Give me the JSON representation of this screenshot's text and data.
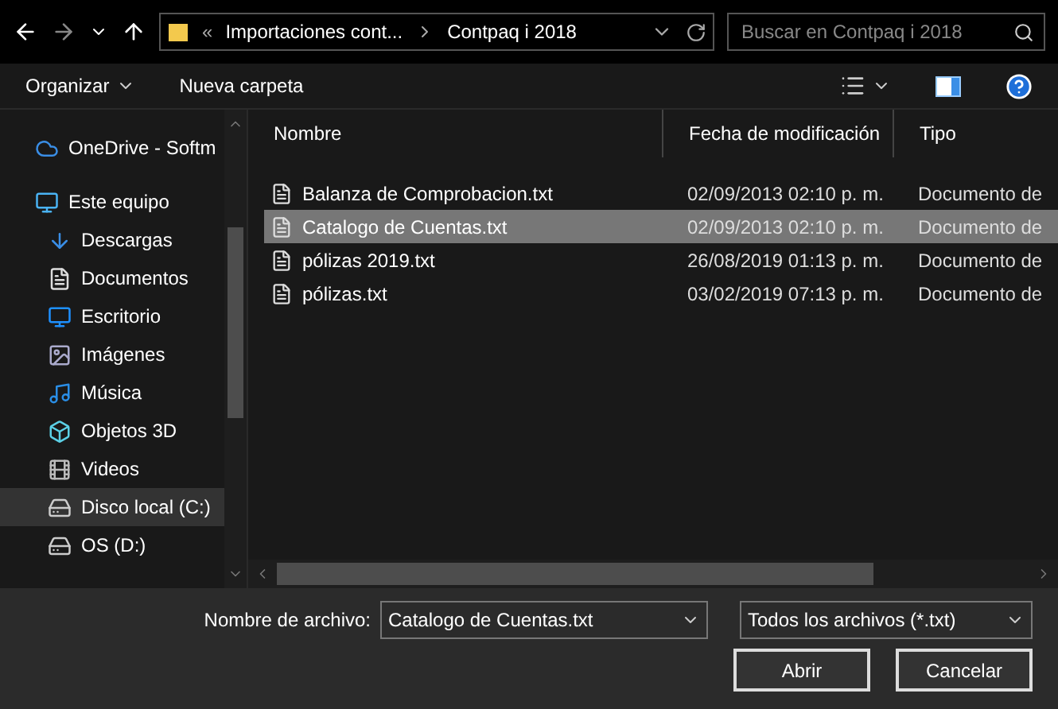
{
  "address_bar": {
    "overflow": "«",
    "segments": [
      "Importaciones cont...",
      "Contpaq i 2018"
    ]
  },
  "search": {
    "placeholder": "Buscar en Contpaq i 2018"
  },
  "toolbar": {
    "organize": "Organizar",
    "new_folder": "Nueva carpeta"
  },
  "sidebar": {
    "items": [
      {
        "label": "OneDrive - Softm",
        "kind": "cloud",
        "selected": false
      },
      {
        "label": "Este equipo",
        "kind": "computer",
        "selected": false,
        "children": [
          {
            "label": "Descargas",
            "kind": "download",
            "selected": false
          },
          {
            "label": "Documentos",
            "kind": "document",
            "selected": false
          },
          {
            "label": "Escritorio",
            "kind": "desktop",
            "selected": false
          },
          {
            "label": "Imágenes",
            "kind": "pictures",
            "selected": false
          },
          {
            "label": "Música",
            "kind": "music",
            "selected": false
          },
          {
            "label": "Objetos 3D",
            "kind": "cube",
            "selected": false
          },
          {
            "label": "Videos",
            "kind": "video",
            "selected": false
          },
          {
            "label": "Disco local (C:)",
            "kind": "system-drive",
            "selected": true
          },
          {
            "label": "OS (D:)",
            "kind": "drive",
            "selected": false
          }
        ]
      }
    ]
  },
  "table": {
    "columns": [
      "Nombre",
      "Fecha de modificación",
      "Tipo"
    ],
    "rows": [
      {
        "name": "Balanza de Comprobacion.txt",
        "date": "02/09/2013 02:10 p. m.",
        "type": "Documento de",
        "selected": false
      },
      {
        "name": "Catalogo de Cuentas.txt",
        "date": "02/09/2013 02:10 p. m.",
        "type": "Documento de",
        "selected": true
      },
      {
        "name": "pólizas 2019.txt",
        "date": "26/08/2019 01:13 p. m.",
        "type": "Documento de",
        "selected": false
      },
      {
        "name": "pólizas.txt",
        "date": "03/02/2019 07:13 p. m.",
        "type": "Documento de",
        "selected": false
      }
    ]
  },
  "footer": {
    "file_name_label": "Nombre de archivo:",
    "file_name": "Catalogo de Cuentas.txt",
    "filter": "Todos los archivos (*.txt)",
    "open": "Abrir",
    "cancel": "Cancelar"
  }
}
